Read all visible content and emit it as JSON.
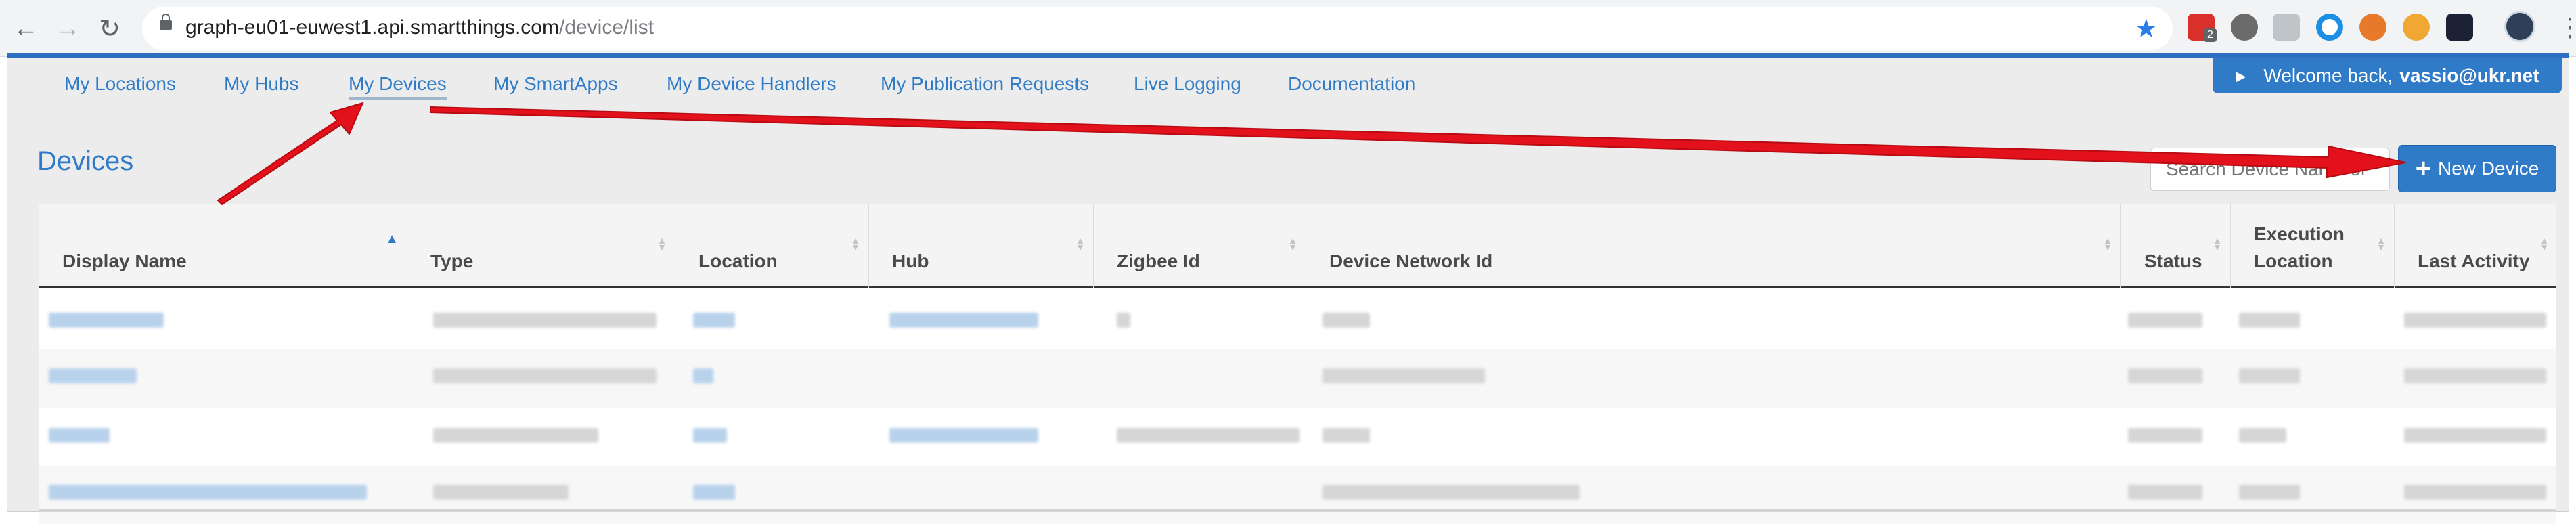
{
  "browser": {
    "url_host": "graph-eu01-euwest1.api.smartthings.com",
    "url_path": "/device/list",
    "extension_badge": "2",
    "icons": [
      "back-icon",
      "forward-icon",
      "reload-icon",
      "lock-icon",
      "star-icon"
    ]
  },
  "nav": {
    "items": [
      {
        "label": "My Locations"
      },
      {
        "label": "My Hubs"
      },
      {
        "label": "My Devices"
      },
      {
        "label": "My SmartApps"
      },
      {
        "label": "My Device Handlers"
      },
      {
        "label": "My Publication Requests"
      },
      {
        "label": "Live Logging"
      },
      {
        "label": "Documentation"
      }
    ],
    "active": "My Devices"
  },
  "welcome": {
    "prefix": "Welcome back,",
    "user": "vassio@ukr.net"
  },
  "page": {
    "title": "Devices",
    "search_placeholder": "Search Device Name or",
    "new_device_label": "New Device"
  },
  "table": {
    "columns": [
      {
        "label": "Display Name"
      },
      {
        "label": "Type"
      },
      {
        "label": "Location"
      },
      {
        "label": "Hub"
      },
      {
        "label": "Zigbee Id"
      },
      {
        "label": "Device Network Id"
      },
      {
        "label": "Status"
      },
      {
        "label": "Execution Location"
      },
      {
        "label": "Last Activity"
      }
    ],
    "sorted_column": "Display Name",
    "row_count_visible": 4
  },
  "colors": {
    "accent": "#2f7bc8",
    "annotation_arrow": "#e3111b",
    "strip": "#2f6fc1"
  }
}
